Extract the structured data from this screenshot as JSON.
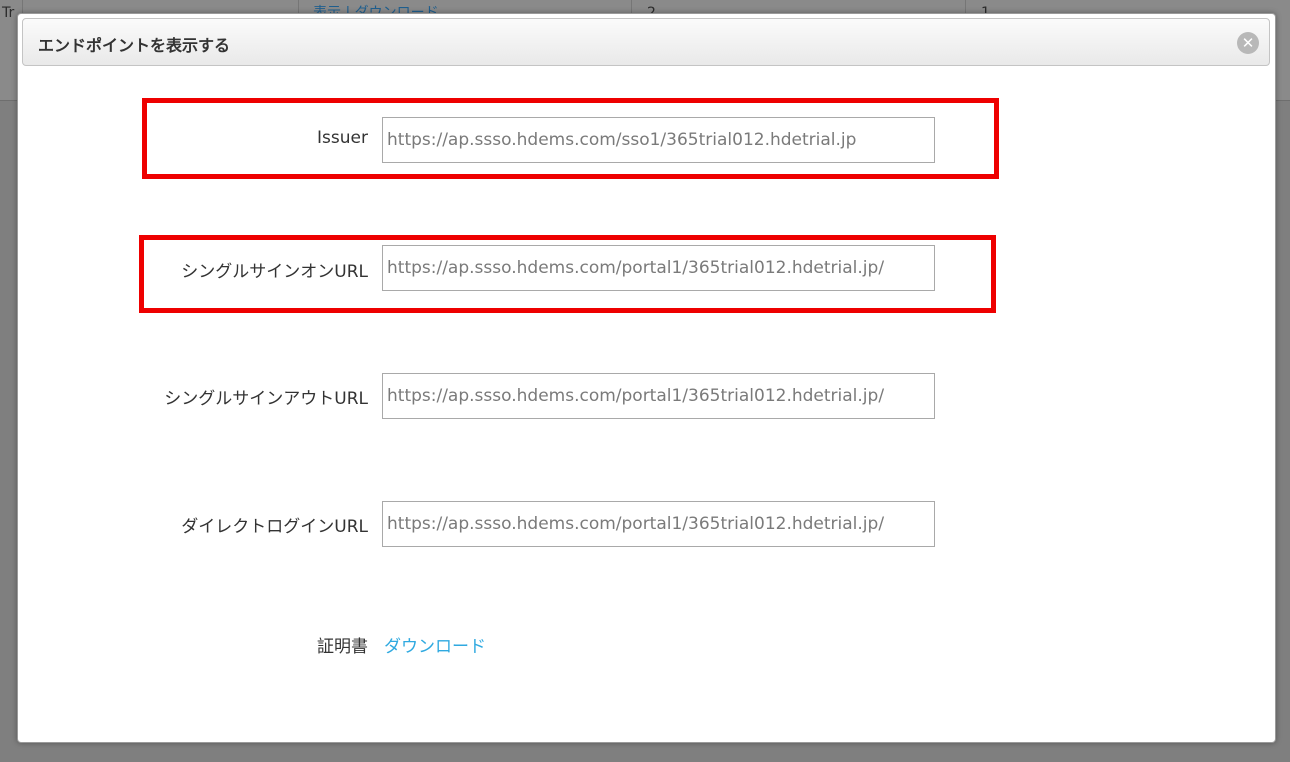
{
  "background": {
    "cells": [
      "Tr",
      "",
      "表示 | ダウンロード",
      "2",
      "1"
    ]
  },
  "dialog": {
    "title": "エンドポイントを表示する",
    "close_icon": "close-icon",
    "close_glyph": "✕"
  },
  "fields": {
    "issuer": {
      "label": "Issuer",
      "value": "https://ap.ssso.hdems.com/sso1/365trial012.hdetrial.jp"
    },
    "sso_url": {
      "label": "シングルサインオンURL",
      "value": "https://ap.ssso.hdems.com/portal1/365trial012.hdetrial.jp/"
    },
    "slo_url": {
      "label": "シングルサインアウトURL",
      "value": "https://ap.ssso.hdems.com/portal1/365trial012.hdetrial.jp/"
    },
    "direct_login_url": {
      "label": "ダイレクトログインURL",
      "value": "https://ap.ssso.hdems.com/portal1/365trial012.hdetrial.jp/"
    }
  },
  "certificate": {
    "label": "証明書",
    "link_label": "ダウンロード"
  },
  "colors": {
    "highlight": "#ee0000",
    "link": "#2fa9e0",
    "overlay": "#7f7f7f"
  }
}
